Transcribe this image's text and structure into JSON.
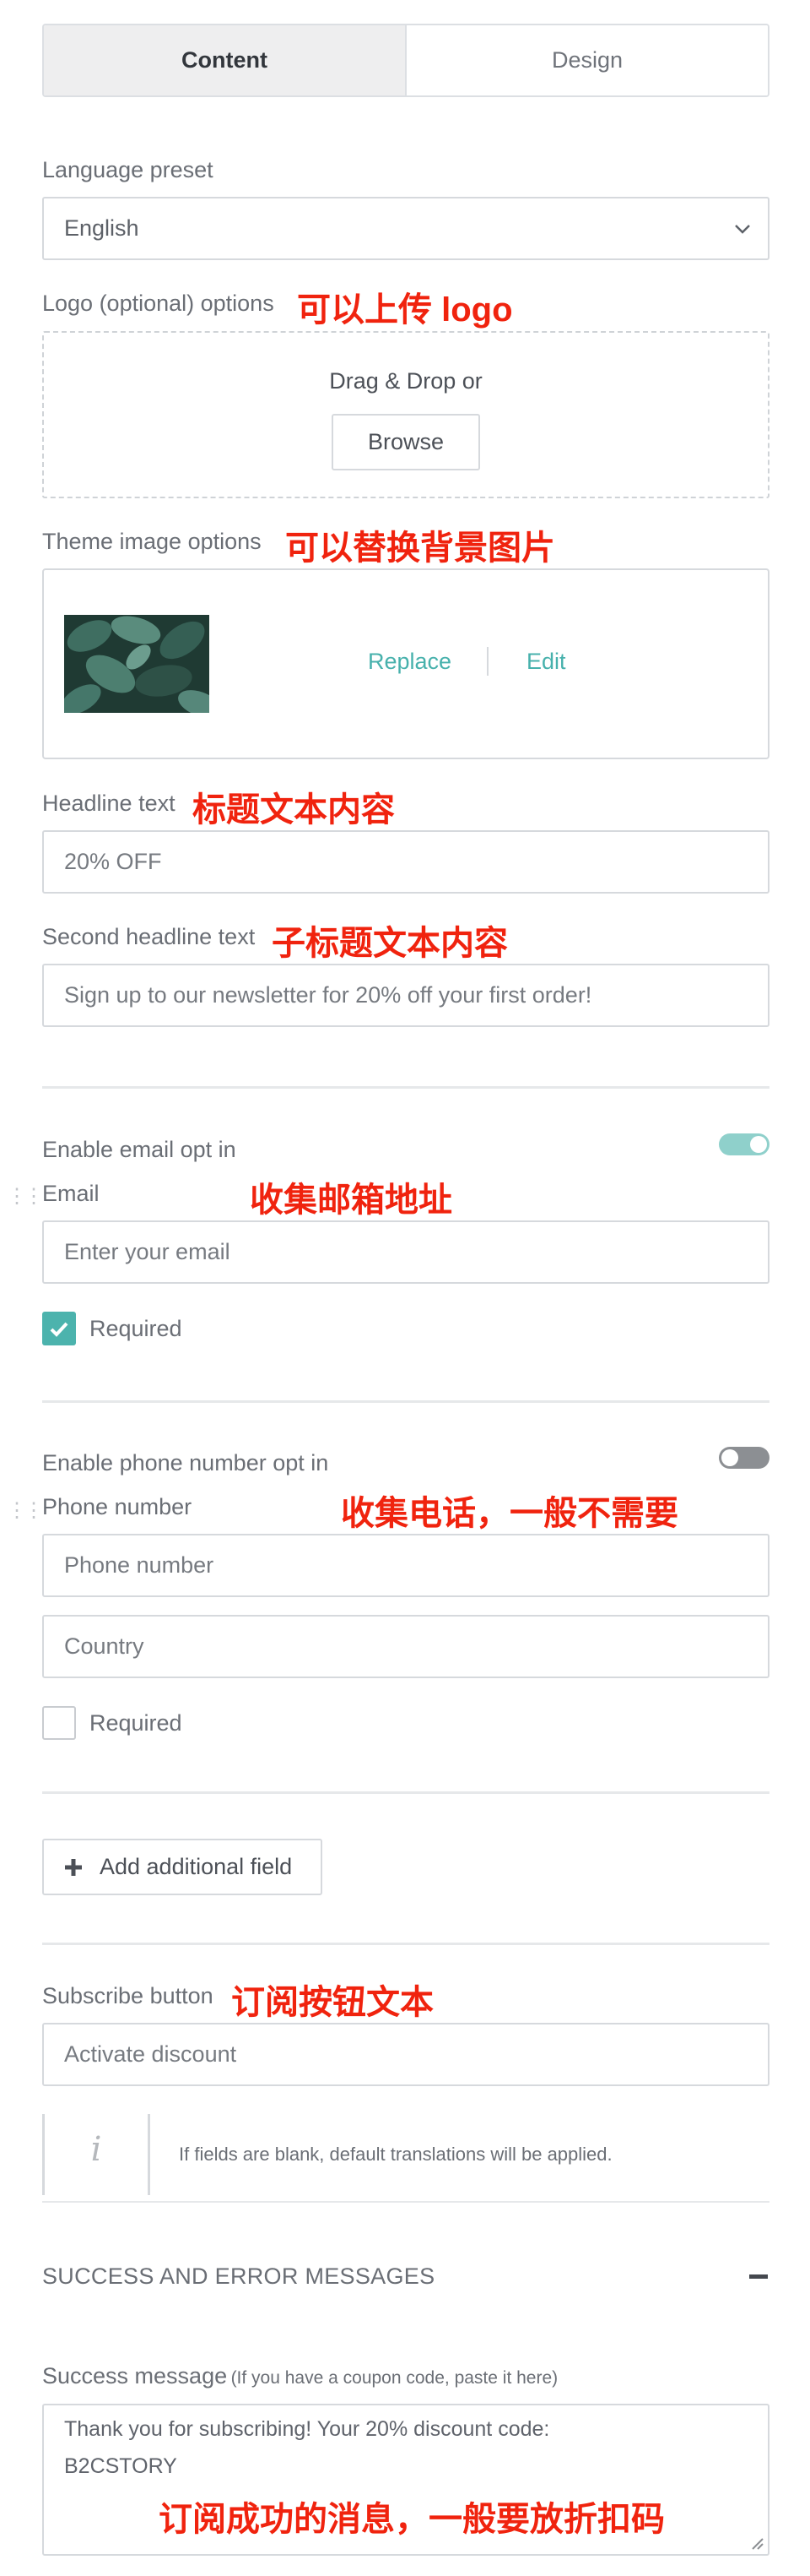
{
  "tabs": {
    "content": "Content",
    "design": "Design"
  },
  "language": {
    "label": "Language preset",
    "value": "English"
  },
  "logo": {
    "label": "Logo (optional) options",
    "note": "可以上传 logo",
    "drop_text": "Drag & Drop or",
    "browse": "Browse"
  },
  "theme": {
    "label": "Theme image options",
    "note": "可以替换背景图片",
    "replace": "Replace",
    "edit": "Edit"
  },
  "headline": {
    "label": "Headline text",
    "note": "标题文本内容",
    "value": "20% OFF"
  },
  "second_headline": {
    "label": "Second headline text",
    "note": "子标题文本内容",
    "value": "Sign up to our newsletter for 20% off your first order!"
  },
  "email": {
    "toggle_label": "Enable email opt in",
    "enabled": true,
    "field_label": "Email",
    "note": "收集邮箱地址",
    "placeholder": "Enter your email",
    "required_label": "Required",
    "required": true
  },
  "phone": {
    "toggle_label": "Enable phone number opt in",
    "enabled": false,
    "field_label": "Phone number",
    "note": "收集电话，一般不需要",
    "placeholder": "Phone number",
    "country_placeholder": "Country",
    "required_label": "Required",
    "required": false
  },
  "add_field": {
    "label": "Add additional field"
  },
  "subscribe": {
    "label": "Subscribe button",
    "note": "订阅按钮文本",
    "value": "Activate discount"
  },
  "info": {
    "text": "If fields are blank, default translations will be applied."
  },
  "messages": {
    "section_title": "SUCCESS AND ERROR MESSAGES",
    "success_label": "Success message",
    "success_hint": "(If you have a coupon code, paste it here)",
    "success_value_line1": "Thank you for subscribing! Your 20% discount code:",
    "success_value_line2": "B2CSTORY",
    "note": "订阅成功的消息，一般要放折扣码"
  },
  "colors": {
    "accent": "#4cb3ad",
    "annotation": "#f0230e"
  }
}
